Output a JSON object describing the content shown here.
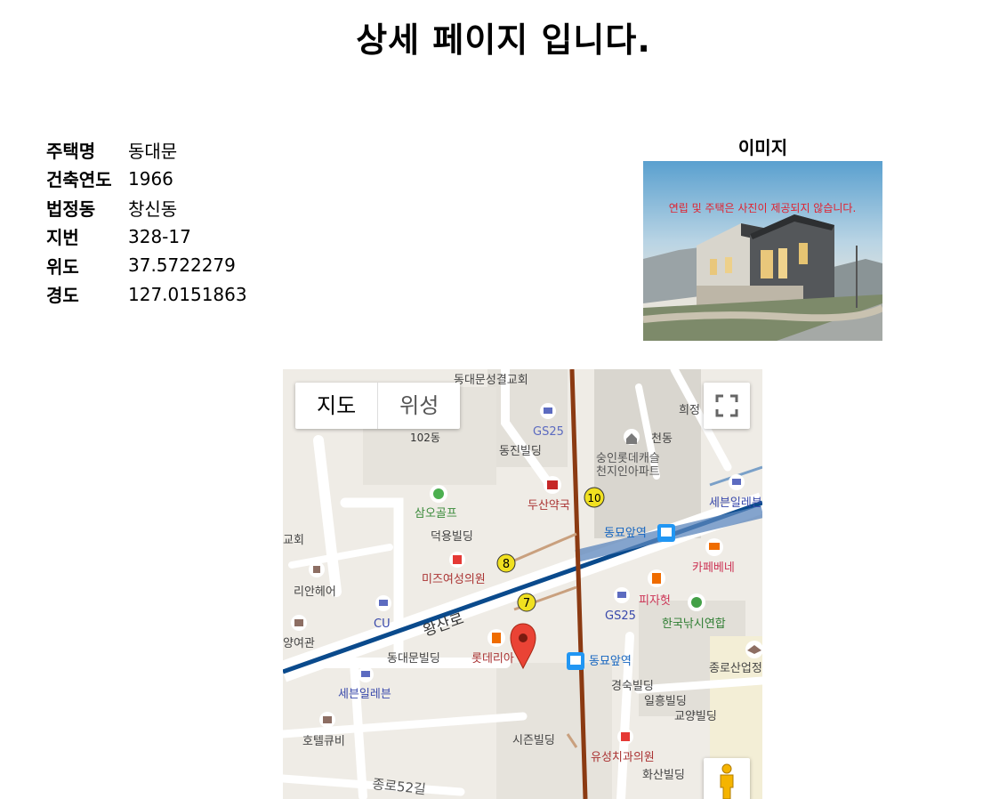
{
  "page": {
    "title": "상세 페이지 입니다."
  },
  "info": [
    {
      "label": "주택명",
      "value": "동대문"
    },
    {
      "label": "건축연도",
      "value": "1966"
    },
    {
      "label": "법정동",
      "value": "창신동"
    },
    {
      "label": "지번",
      "value": "328-17"
    },
    {
      "label": "위도",
      "value": "37.5722279"
    },
    {
      "label": "경도",
      "value": "127.0151863"
    }
  ],
  "image": {
    "title": "이미지",
    "notice": "연립 및 주택은 사진이 제공되지 않습니다."
  },
  "map": {
    "type_map": "지도",
    "type_satellite": "위성",
    "fullscreen_icon": "fullscreen-icon",
    "pegman_icon": "pegman-icon",
    "marker_icon": "marker-icon",
    "labels": {
      "church": "동대문성결교회",
      "hj": "희정",
      "cd": "천동",
      "dong102": "102동",
      "gs25_top": "GS25",
      "dongjin": "동진빌딩",
      "apt1": "숭인롯데캐슬",
      "apt2": "천지인아파트",
      "samo": "삼오골프",
      "doosan": "두산약국",
      "seven_top": "세븐일레븐",
      "gyohoe": "교회",
      "deokyong": "덕용빌딩",
      "dongmyo_top": "동묘앞역",
      "mizu": "미즈여성의원",
      "cafe": "카페베네",
      "rian": "리안헤어",
      "pizza": "피자헛",
      "cu": "CU",
      "wangsan": "왕산로",
      "gs25_mid": "GS25",
      "fishing": "한국낚시연합",
      "yangyeo": "양여관",
      "lotteria": "롯데리아",
      "ddm_bldg": "동대문빌딩",
      "dongmyo": "동묘앞역",
      "jongno_sanup": "종로산업정",
      "seven_bot": "세븐일레븐",
      "gyeongsuk": "경숙빌딩",
      "ilheung": "일흥빌딩",
      "gyoyang": "교양빌딩",
      "hotel": "호텔큐비",
      "sizen": "시즌빌딩",
      "yuseong": "유성치과의원",
      "hwasan": "화산빌딩",
      "jongno52": "종로52길",
      "line8": "8",
      "line7": "7",
      "line10": "10"
    },
    "colors": {
      "base": "#efece6",
      "road": "#ffffff",
      "line1": "#0a4a8c",
      "line4": "#8b3a12",
      "pin": "#ea4335"
    }
  }
}
